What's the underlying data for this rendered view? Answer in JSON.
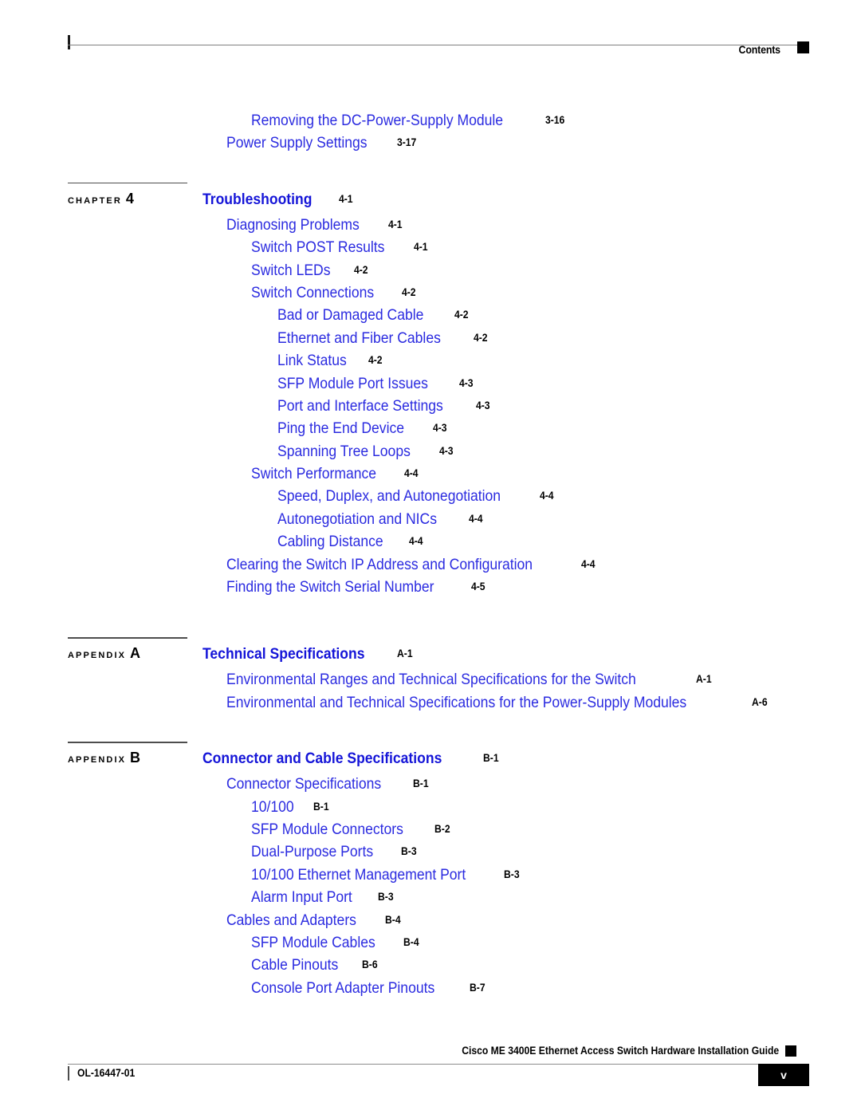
{
  "header": {
    "label": "Contents",
    "marker_icon": "black-square-icon"
  },
  "colors": {
    "link_blue": "#2b2be0",
    "heading_blue": "#1515d8",
    "page_number_black": "#000000",
    "rule_gray": "#808080"
  },
  "toc": {
    "top_entries": [
      {
        "level": 3,
        "title": "Removing the DC-Power-Supply Module",
        "page": "3-16"
      },
      {
        "level": 2,
        "title": "Power Supply Settings",
        "page": "3-17"
      }
    ],
    "chapter_4": {
      "marker_word": "C H A P T E R",
      "marker_number": "4",
      "title": "Troubleshooting",
      "page": "4-1",
      "entries": [
        {
          "level": 2,
          "title": "Diagnosing Problems",
          "page": "4-1"
        },
        {
          "level": 3,
          "title": "Switch POST Results",
          "page": "4-1"
        },
        {
          "level": 3,
          "title": "Switch LEDs",
          "page": "4-2"
        },
        {
          "level": 3,
          "title": "Switch Connections",
          "page": "4-2"
        },
        {
          "level": 4,
          "title": "Bad or Damaged Cable",
          "page": "4-2"
        },
        {
          "level": 4,
          "title": "Ethernet and Fiber Cables",
          "page": "4-2"
        },
        {
          "level": 4,
          "title": "Link Status",
          "page": "4-2"
        },
        {
          "level": 4,
          "title": "SFP Module Port Issues",
          "page": "4-3"
        },
        {
          "level": 4,
          "title": "Port and Interface Settings",
          "page": "4-3"
        },
        {
          "level": 4,
          "title": "Ping the End Device",
          "page": "4-3"
        },
        {
          "level": 4,
          "title": "Spanning Tree Loops",
          "page": "4-3"
        },
        {
          "level": 3,
          "title": "Switch Performance",
          "page": "4-4"
        },
        {
          "level": 4,
          "title": "Speed, Duplex, and Autonegotiation",
          "page": "4-4"
        },
        {
          "level": 4,
          "title": "Autonegotiation and NICs",
          "page": "4-4"
        },
        {
          "level": 4,
          "title": "Cabling Distance",
          "page": "4-4"
        },
        {
          "level": 2,
          "title": "Clearing the Switch IP Address and Configuration",
          "page": "4-4"
        },
        {
          "level": 2,
          "title": "Finding the Switch Serial Number",
          "page": "4-5"
        }
      ]
    },
    "appendix_a": {
      "marker_word": "A P P E N D I X",
      "marker_number": "A",
      "title": "Technical Specifications",
      "page": "A-1",
      "entries": [
        {
          "level": 2,
          "title": "Environmental Ranges and Technical Specifications for the Switch",
          "page": "A-1"
        },
        {
          "level": 2,
          "title": "Environmental and Technical Specifications for the Power-Supply Modules",
          "page": "A-6"
        }
      ]
    },
    "appendix_b": {
      "marker_word": "A P P E N D I X",
      "marker_number": "B",
      "title": "Connector and Cable Specifications",
      "page": "B-1",
      "entries": [
        {
          "level": 2,
          "title": "Connector Specifications",
          "page": "B-1"
        },
        {
          "level": 3,
          "title": "10/100",
          "page": "B-1"
        },
        {
          "level": 3,
          "title": "SFP Module Connectors",
          "page": "B-2"
        },
        {
          "level": 3,
          "title": "Dual-Purpose Ports",
          "page": "B-3"
        },
        {
          "level": 3,
          "title": "10/100 Ethernet Management Port",
          "page": "B-3"
        },
        {
          "level": 3,
          "title": "Alarm Input Port",
          "page": "B-3"
        },
        {
          "level": 2,
          "title": "Cables and Adapters",
          "page": "B-4"
        },
        {
          "level": 3,
          "title": "SFP Module Cables",
          "page": "B-4"
        },
        {
          "level": 3,
          "title": "Cable Pinouts",
          "page": "B-6"
        },
        {
          "level": 3,
          "title": "Console Port Adapter Pinouts",
          "page": "B-7"
        }
      ]
    }
  },
  "footer": {
    "guide_title": "Cisco ME 3400E Ethernet Access Switch Hardware Installation Guide",
    "document_id": "OL-16447-01",
    "page_number": "v",
    "marker_icon": "black-square-icon"
  }
}
